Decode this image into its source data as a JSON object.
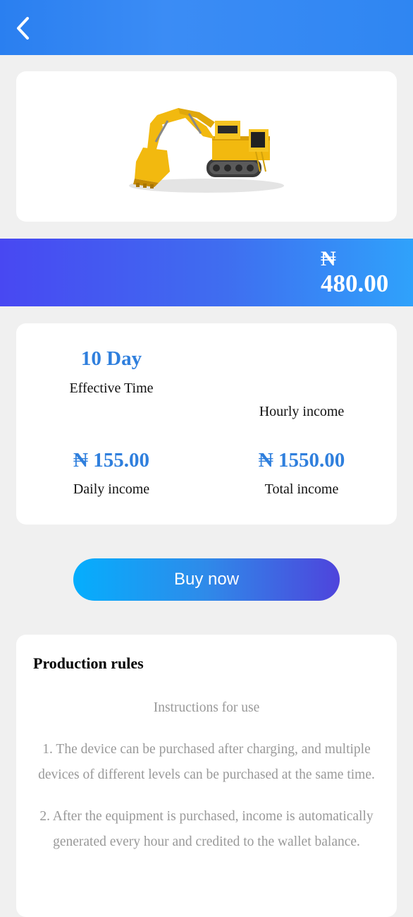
{
  "header": {
    "back_icon": "chevron-left-icon"
  },
  "product": {
    "image_alt": "yellow mining excavator"
  },
  "price": {
    "currency": "₦",
    "amount": "480.00"
  },
  "stats": {
    "effective_time_value": "10 Day",
    "effective_time_label": "Effective Time",
    "hourly_income_value": "",
    "hourly_income_label": "Hourly income",
    "daily_income_value": "₦ 155.00",
    "daily_income_label": "Daily income",
    "total_income_value": "₦ 1550.00",
    "total_income_label": "Total income"
  },
  "buy_button": {
    "label": "Buy now"
  },
  "rules": {
    "title": "Production rules",
    "subtitle": "Instructions for use",
    "items": [
      "1. The device can be purchased after charging, and multiple devices of different levels can be purchased at the same time.",
      "2. After the equipment is purchased, income is automatically generated every hour and credited to the wallet balance."
    ]
  },
  "colors": {
    "header_blue": "#2a7ff0",
    "accent_blue": "#2f7fdd",
    "button_start": "#05aefd",
    "button_end": "#4e44dc"
  }
}
